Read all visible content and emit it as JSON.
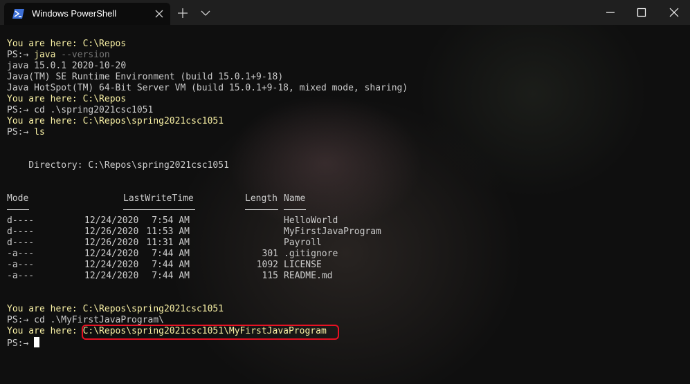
{
  "window": {
    "tab_title": "Windows PowerShell"
  },
  "icons": {
    "tab": "powershell-icon",
    "close_tab": "close-icon",
    "new_tab": "plus-icon",
    "dropdown": "chevron-down-icon",
    "minimize": "minimize-icon",
    "maximize": "maximize-icon",
    "close": "close-icon"
  },
  "colors": {
    "prompt_yellow": "#f9f1a5",
    "text": "#cccccc",
    "highlight_border": "#e81123",
    "muted_arg": "#767676"
  },
  "terminal": {
    "prompt": "PS:→",
    "here_label": "You are here:",
    "l1_path": "C:\\Repos",
    "l2_cmd": "java",
    "l2_arg": "--version",
    "l3": "java 15.0.1 2020-10-20",
    "l4": "Java(TM) SE Runtime Environment (build 15.0.1+9-18)",
    "l5": "Java HotSpot(TM) 64-Bit Server VM (build 15.0.1+9-18, mixed mode, sharing)",
    "l6_path": "C:\\Repos",
    "l7_cmd": "cd .\\spring2021csc1051",
    "l8_path": "C:\\Repos\\spring2021csc1051",
    "l9_cmd": "ls",
    "directory_line": "    Directory: C:\\Repos\\spring2021csc1051",
    "header_mode": "Mode",
    "header_lwt": "LastWriteTime",
    "header_length": "Length",
    "header_name": "Name",
    "rows": [
      {
        "mode": "d----",
        "date": "12/24/2020",
        "time": "7:54 AM",
        "length": "",
        "name": "HelloWorld"
      },
      {
        "mode": "d----",
        "date": "12/26/2020",
        "time": "11:53 AM",
        "length": "",
        "name": "MyFirstJavaProgram"
      },
      {
        "mode": "d----",
        "date": "12/26/2020",
        "time": "11:31 AM",
        "length": "",
        "name": "Payroll"
      },
      {
        "mode": "-a---",
        "date": "12/24/2020",
        "time": "7:44 AM",
        "length": "301",
        "name": ".gitignore"
      },
      {
        "mode": "-a---",
        "date": "12/24/2020",
        "time": "7:44 AM",
        "length": "1092",
        "name": "LICENSE"
      },
      {
        "mode": "-a---",
        "date": "12/24/2020",
        "time": "7:44 AM",
        "length": "115",
        "name": "README.md"
      }
    ],
    "l10_path": "C:\\Repos\\spring2021csc1051",
    "l11_cmd": "cd .\\MyFirstJavaProgram\\",
    "l12_path": "C:\\Repos\\spring2021csc1051\\MyFirstJavaProgram"
  }
}
